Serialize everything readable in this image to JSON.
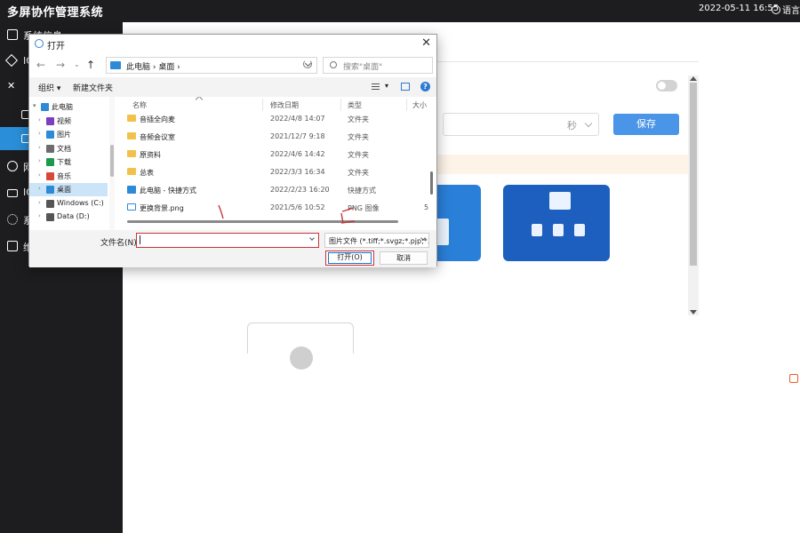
{
  "app": {
    "title": "多屏协作管理系统",
    "datetime": "2022-05-11 16:55",
    "language_label": "语言 -"
  },
  "sidebar": {
    "items": [
      {
        "label": "系统信息"
      },
      {
        "label": "IO"
      },
      {
        "label": ""
      },
      {
        "label": ""
      },
      {
        "label": ""
      },
      {
        "label": "网"
      },
      {
        "label": "IO"
      },
      {
        "label": "系"
      },
      {
        "label": "维"
      }
    ]
  },
  "main": {
    "time_unit": "秒",
    "save_label": "保存"
  },
  "dialog": {
    "title": "打开",
    "address": {
      "crumbs": "此电脑  ›  桌面  ›"
    },
    "search_placeholder": "搜索\"桌面\"",
    "toolbar": {
      "organize_label": "组织 ▾",
      "new_folder_label": "新建文件夹",
      "view_dropdown": "▾",
      "help": "?"
    },
    "nav_items": [
      {
        "label": "此电脑",
        "arrow": "▾",
        "indent": 0,
        "icon_color": "#2c8ad6"
      },
      {
        "label": "视频",
        "arrow": "›",
        "indent": 1,
        "icon_color": "#7b3fbf"
      },
      {
        "label": "图片",
        "arrow": "›",
        "indent": 1,
        "icon_color": "#2c8ad6"
      },
      {
        "label": "文档",
        "arrow": "›",
        "indent": 1,
        "icon_color": "#6c6c6c"
      },
      {
        "label": "下载",
        "arrow": "›",
        "indent": 1,
        "icon_color": "#1b9a4a"
      },
      {
        "label": "音乐",
        "arrow": "›",
        "indent": 1,
        "icon_color": "#d9473b"
      },
      {
        "label": "桌面",
        "arrow": "›",
        "indent": 1,
        "icon_color": "#2c8ad6",
        "selected": true
      },
      {
        "label": "Windows (C:)",
        "arrow": "›",
        "indent": 1,
        "icon_color": "#555555"
      },
      {
        "label": "Data (D:)",
        "arrow": "›",
        "indent": 1,
        "icon_color": "#555555"
      }
    ],
    "columns": {
      "name": "名称",
      "modified": "修改日期",
      "type": "类型",
      "size": "大小"
    },
    "files": [
      {
        "name": "音插全向麦",
        "modified": "2022/4/8 14:07",
        "type": "文件夹",
        "size": "",
        "kind": "folder"
      },
      {
        "name": "音频会议室",
        "modified": "2021/12/7 9:18",
        "type": "文件夹",
        "size": "",
        "kind": "folder"
      },
      {
        "name": "原资料",
        "modified": "2022/4/6 14:42",
        "type": "文件夹",
        "size": "",
        "kind": "folder"
      },
      {
        "name": "总表",
        "modified": "2022/3/3 16:34",
        "type": "文件夹",
        "size": "",
        "kind": "folder"
      },
      {
        "name": "此电脑 - 快捷方式",
        "modified": "2022/2/23 16:20",
        "type": "快捷方式",
        "size": "",
        "kind": "shortcut"
      },
      {
        "name": "更换背景.png",
        "modified": "2021/5/6 10:52",
        "type": "PNG 图像",
        "size": "5",
        "kind": "image"
      }
    ],
    "filename_label": "文件名(N):",
    "filename_value": "",
    "filter_label": "图片文件 (*.tiff;*.svgz;*.pjp;*.jpg",
    "open_label": "打开(O)",
    "cancel_label": "取消"
  },
  "annotations": {
    "stroke_color": "#c8343b",
    "labels": [
      "1",
      "2"
    ]
  }
}
